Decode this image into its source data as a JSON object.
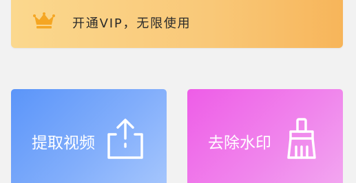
{
  "vip_banner": {
    "text": "开通VIP，无限使用",
    "icon": "crown-icon",
    "color": "#f5a623"
  },
  "tools": [
    {
      "label": "提取视频",
      "icon": "upload-icon",
      "gradient": [
        "#5b95f9",
        "#a7c7fd"
      ]
    },
    {
      "label": "去除水印",
      "icon": "brush-icon",
      "gradient": [
        "#ee5de7",
        "#f2a8f0"
      ]
    }
  ]
}
